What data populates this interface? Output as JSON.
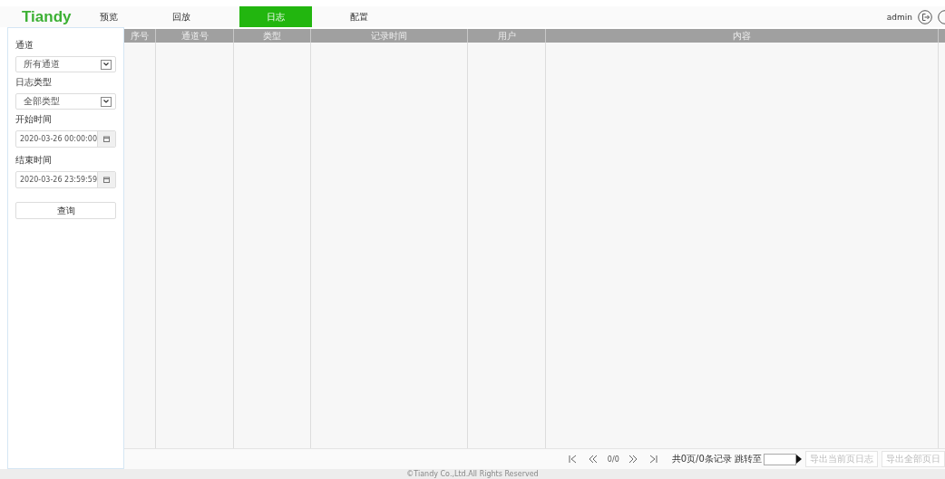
{
  "header": {
    "logo": "Tiandy",
    "tabs": [
      {
        "label": "预览",
        "selected": false
      },
      {
        "label": "回放",
        "selected": false
      },
      {
        "label": "日志",
        "selected": true
      },
      {
        "label": "配置",
        "selected": false
      }
    ],
    "user": "admin"
  },
  "sidebar": {
    "filters": [
      {
        "kind": "select",
        "label": "通道",
        "value": "所有通道"
      },
      {
        "kind": "select",
        "label": "日志类型",
        "value": "全部类型"
      },
      {
        "kind": "date",
        "label": "开始时间",
        "value": "2020-03-26 00:00:00"
      },
      {
        "kind": "date",
        "label": "结束时间",
        "value": "2020-03-26 23:59:59"
      }
    ],
    "query_button": "查询"
  },
  "table": {
    "columns": [
      "序号",
      "通道号",
      "类型",
      "记录时间",
      "用户",
      "内容"
    ]
  },
  "pagination": {
    "page": "0/0",
    "summary": "共0页/0条记录 跳转至",
    "buttons": [
      {
        "label": "导出当前页日志",
        "disabled": true
      },
      {
        "label": "导出全部页日",
        "disabled": true
      }
    ]
  },
  "footer": "©Tiandy Co.,Ltd.All Rights Reserved"
}
